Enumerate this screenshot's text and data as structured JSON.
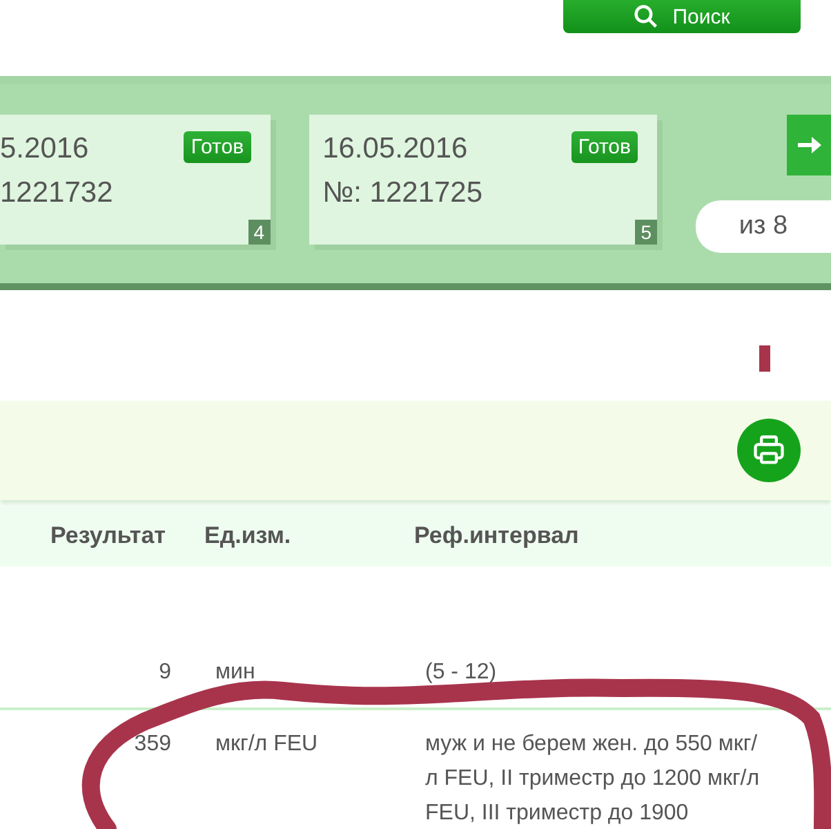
{
  "search_button": {
    "label": "Поиск"
  },
  "orders": [
    {
      "date": "5.2016",
      "number": "1221732",
      "status": "Готов",
      "index": "4"
    },
    {
      "date": "16.05.2016",
      "number": "№: 1221725",
      "status": "Готов",
      "index": "5"
    }
  ],
  "pager": {
    "total": "из 8"
  },
  "table": {
    "columns": [
      "Результат",
      "Ед.изм.",
      "Реф.интервал"
    ],
    "rows": [
      {
        "result": "9",
        "unit": "мин",
        "reference": "(5 - 12)"
      },
      {
        "result": "359",
        "unit": "мкг/л FEU",
        "reference": "муж и не берем жен. до 550 мкг/л FEU, II триместр до 1200 мкг/л FEU, III триместр до 1900"
      }
    ]
  }
}
